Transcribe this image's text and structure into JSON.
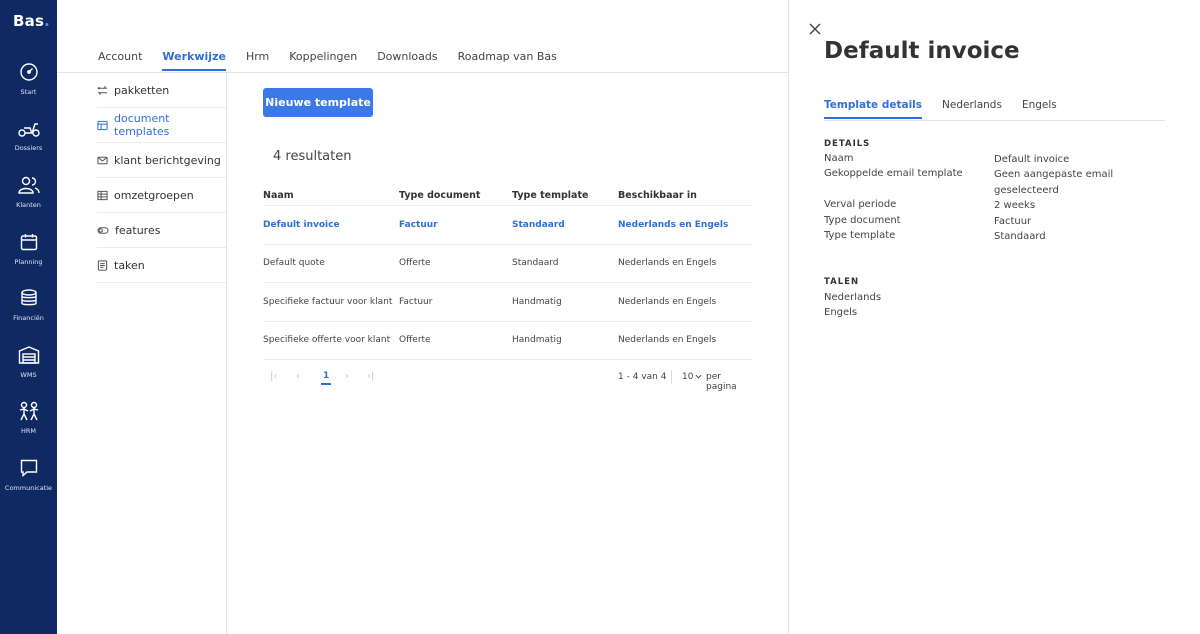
{
  "app": {
    "logo": "Bas",
    "logo_dot": "."
  },
  "rail": [
    {
      "key": "start",
      "label": "Start",
      "icon": "gauge-icon"
    },
    {
      "key": "dossiers",
      "label": "Dossiers",
      "icon": "scooter-icon"
    },
    {
      "key": "klanten",
      "label": "Klanten",
      "icon": "users-icon"
    },
    {
      "key": "planning",
      "label": "Planning",
      "icon": "calendar-icon"
    },
    {
      "key": "financien",
      "label": "Financiën",
      "icon": "coins-icon"
    },
    {
      "key": "wms",
      "label": "WMS",
      "icon": "warehouse-icon"
    },
    {
      "key": "hrm",
      "label": "HRM",
      "icon": "people-icon"
    },
    {
      "key": "communicatie",
      "label": "Communicatie",
      "icon": "chat-icon"
    }
  ],
  "topnav": [
    {
      "label": "Account"
    },
    {
      "label": "Werkwijze",
      "active": true
    },
    {
      "label": "Hrm"
    },
    {
      "label": "Koppelingen"
    },
    {
      "label": "Downloads"
    },
    {
      "label": "Roadmap van Bas"
    }
  ],
  "subnav": [
    {
      "label": "pakketten",
      "icon": "arrows-swap-icon"
    },
    {
      "label": "document templates",
      "icon": "layout-icon",
      "active": true
    },
    {
      "label": "klant berichtgeving",
      "icon": "mail-icon"
    },
    {
      "label": "omzetgroepen",
      "icon": "table-icon"
    },
    {
      "label": "features",
      "icon": "toggle-icon"
    },
    {
      "label": "taken",
      "icon": "checklist-icon"
    }
  ],
  "main": {
    "new_button": "Nieuwe template",
    "results": "4 resultaten",
    "columns": [
      "Naam",
      "Type document",
      "Type template",
      "Beschikbaar in"
    ],
    "rows": [
      [
        "Default invoice",
        "Factuur",
        "Standaard",
        "Nederlands en Engels"
      ],
      [
        "Default quote",
        "Offerte",
        "Standaard",
        "Nederlands en Engels"
      ],
      [
        "Specifieke factuur voor klant",
        "Factuur",
        "Handmatig",
        "Nederlands en Engels"
      ],
      [
        "Specifieke offerte voor klant",
        "Offerte",
        "Handmatig",
        "Nederlands en Engels"
      ]
    ],
    "pagination": {
      "current_page": "1",
      "range": "1 - 4 van 4",
      "per_page": "10",
      "per_page_label": "per pagina"
    }
  },
  "panel": {
    "title": "Default invoice",
    "tabs": [
      {
        "label": "Template details",
        "active": true
      },
      {
        "label": "Nederlands"
      },
      {
        "label": "Engels"
      }
    ],
    "details_heading": "DETAILS",
    "details": [
      {
        "label": "Naam",
        "value": "Default invoice"
      },
      {
        "label": "Gekoppelde email template",
        "value": "Geen aangepaste email geselecteerd"
      },
      {
        "label": "Verval periode",
        "value": "2 weeks"
      },
      {
        "label": "Type document",
        "value": "Factuur"
      },
      {
        "label": "Type template",
        "value": "Standaard"
      }
    ],
    "languages_heading": "TALEN",
    "languages": [
      "Nederlands",
      "Engels"
    ]
  },
  "colors": {
    "rail": "#0f2a63",
    "accent": "#2f6fdc",
    "button": "#3b79e6"
  }
}
